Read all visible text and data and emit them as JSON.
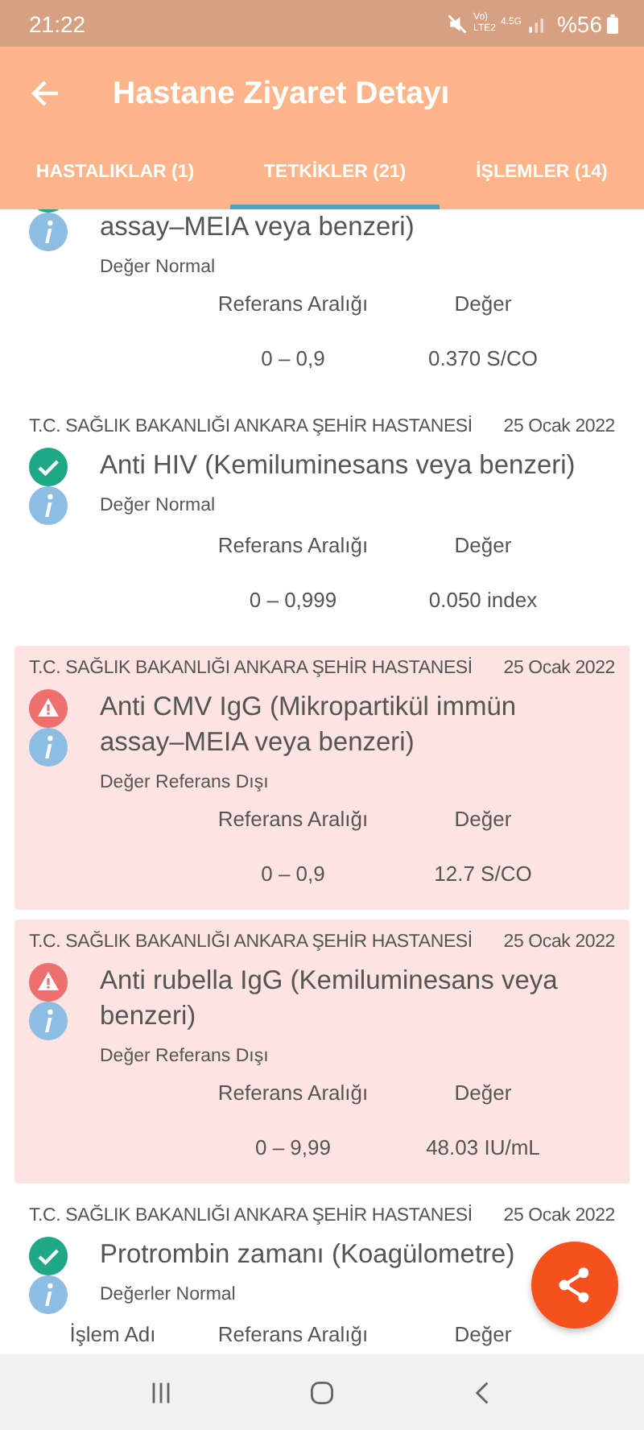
{
  "status_bar": {
    "time": "21:22",
    "volte": "Vo)",
    "lte": "LTE2",
    "network": "4.5G",
    "battery": "%56"
  },
  "app_bar": {
    "title": "Hastane Ziyaret Detayı"
  },
  "tabs": [
    {
      "label": "HASTALIKLAR (1)",
      "selected": false
    },
    {
      "label": "TETKİKLER (21)",
      "selected": true
    },
    {
      "label": "İŞLEMLER (14)",
      "selected": false
    }
  ],
  "results": [
    {
      "cut": true,
      "name": "assay–MEIA veya benzeri)",
      "kind": "normal",
      "status_text": "Değer Normal",
      "ref_header": "Referans Aralığı",
      "value_header": "Değer",
      "range": "0 – 0,9",
      "value": "0.370 S/CO"
    },
    {
      "hospital": "T.C. SAĞLIK BAKANLIĞI ANKARA ŞEHİR HASTANESİ",
      "date": "25 Ocak 2022",
      "name": "Anti HIV (Kemiluminesans veya benzeri)",
      "kind": "normal",
      "status_text": "Değer Normal",
      "ref_header": "Referans Aralığı",
      "value_header": "Değer",
      "range": "0 – 0,999",
      "value": "0.050 index"
    },
    {
      "hospital": "T.C. SAĞLIK BAKANLIĞI ANKARA ŞEHİR HASTANESİ",
      "date": "25 Ocak 2022",
      "name": "Anti CMV IgG (Mikropartikül immün assay–MEIA veya benzeri)",
      "kind": "out_of_range",
      "status_text": "Değer Referans Dışı",
      "ref_header": "Referans Aralığı",
      "value_header": "Değer",
      "range": "0 – 0,9",
      "value": "12.7 S/CO"
    },
    {
      "hospital": "T.C. SAĞLIK BAKANLIĞI ANKARA ŞEHİR HASTANESİ",
      "date": "25 Ocak 2022",
      "name": "Anti rubella IgG (Kemiluminesans veya benzeri)",
      "kind": "out_of_range",
      "status_text": "Değer Referans Dışı",
      "ref_header": "Referans Aralığı",
      "value_header": "Değer",
      "range": "0 – 9,99",
      "value": "48.03 IU/mL"
    },
    {
      "hospital": "T.C. SAĞLIK BAKANLIĞI ANKARA ŞEHİR HASTANESİ",
      "date": "25 Ocak 2022",
      "name": "Protrombin zamanı (Koagülometre)",
      "kind": "normal",
      "status_text": "Değerler Normal",
      "name_header": "İşlem Adı",
      "ref_header": "Referans Aralığı",
      "value_header": "Değer"
    }
  ]
}
